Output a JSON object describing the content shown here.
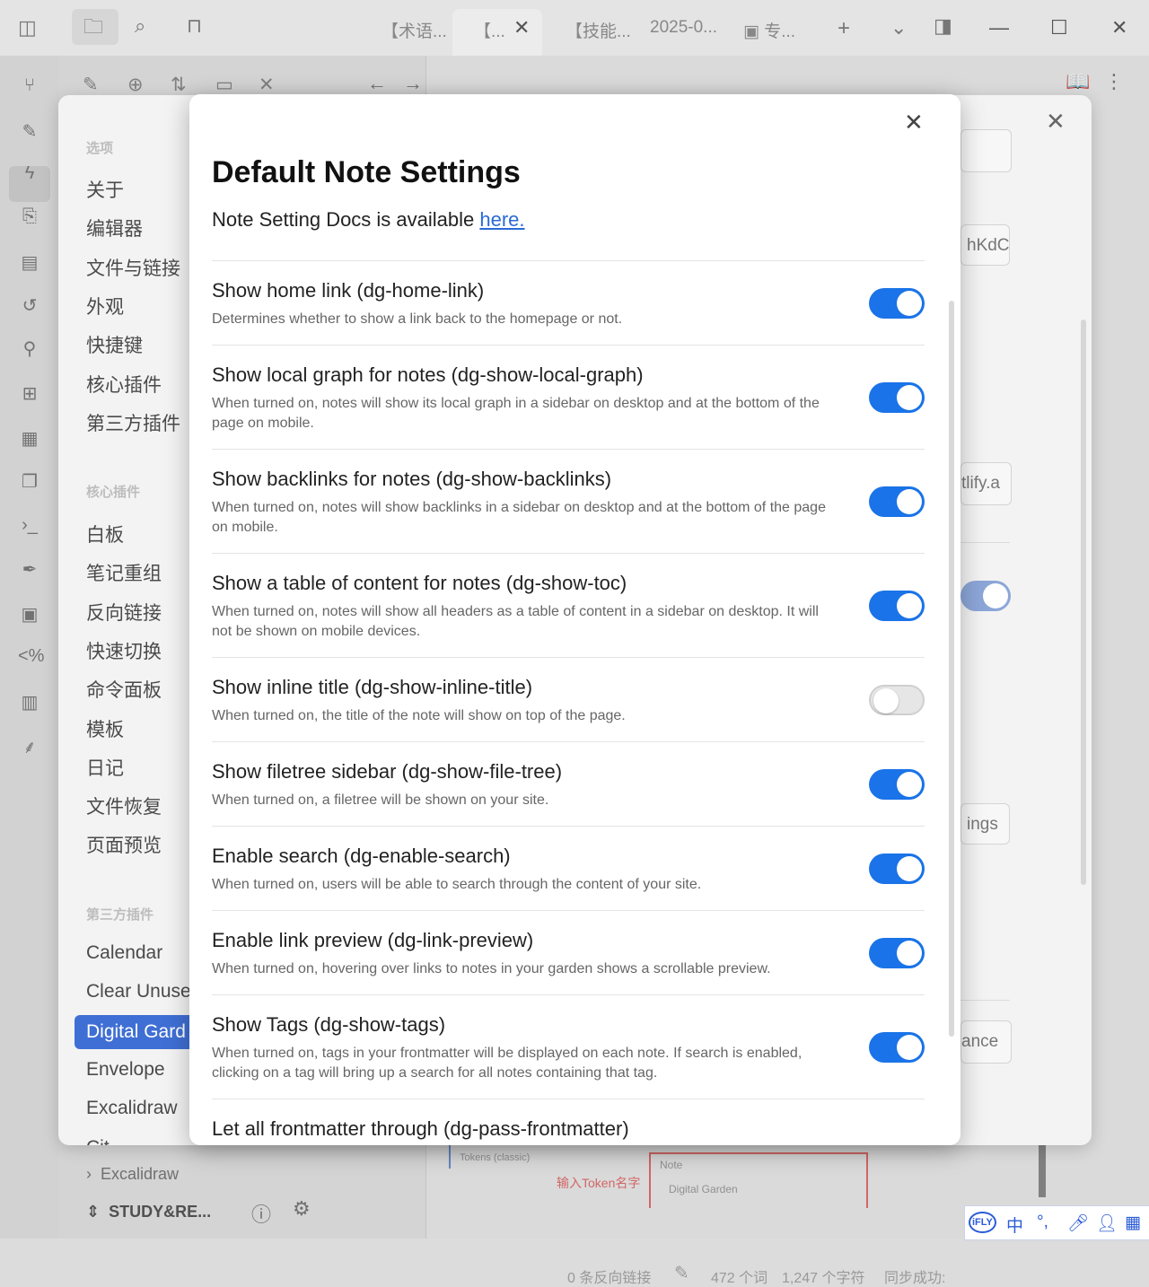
{
  "titlebar": {
    "tabs": [
      {
        "label": "【术语..."
      },
      {
        "label": "【..."
      },
      {
        "label": "【技能..."
      },
      {
        "label": "2025-0..."
      },
      {
        "label": "专..."
      }
    ],
    "icons": {
      "sidebar_toggle": "sidebar-icon",
      "files": "folder-icon",
      "search": "search-icon",
      "bookmarks": "bookmark-icon",
      "new_tab": "plus-icon",
      "tab_list": "chevron-down-icon",
      "right_sidebar": "sidebar-right-icon",
      "minimize": "minimize-icon",
      "maximize": "maximize-icon",
      "close": "close-icon"
    }
  },
  "file_pane": {
    "bottom_folder": "Excalidraw",
    "vault_name": "STUDY&RE..."
  },
  "statusbar": {
    "backlinks": "0 条反向链接",
    "words": "472 个词",
    "chars": "1,247 个字符",
    "sync": "同步成功:"
  },
  "editor_preview": {
    "tokens_label": "Tokens (classic)",
    "note_label": "Note",
    "input_hint": "输入Token名字",
    "field_value": "Digital Garden"
  },
  "settings": {
    "section_options": "选项",
    "options": [
      "关于",
      "编辑器",
      "文件与链接",
      "外观",
      "快捷键",
      "核心插件",
      "第三方插件"
    ],
    "section_core": "核心插件",
    "core_plugins": [
      "白板",
      "笔记重组",
      "反向链接",
      "快速切换",
      "命令面板",
      "模板",
      "日记",
      "文件恢复",
      "页面预览"
    ],
    "section_community": "第三方插件",
    "community_plugins": [
      "Calendar",
      "Clear Unuse",
      "Digital Gard",
      "Envelope",
      "Excalidraw",
      "Cit"
    ],
    "selected_plugin": "Digital Gard",
    "peek_fields": [
      "hKdC",
      "tlify.a",
      "ings",
      "ance"
    ]
  },
  "dialog": {
    "title": "Default Note Settings",
    "docs_text": "Note Setting Docs is available ",
    "docs_link": "here.",
    "rows": [
      {
        "name": "Show home link (dg-home-link)",
        "desc": "Determines whether to show a link back to the homepage or not.",
        "on": true
      },
      {
        "name": "Show local graph for notes (dg-show-local-graph)",
        "desc": "When turned on, notes will show its local graph in a sidebar on desktop and at the bottom of the page on mobile.",
        "on": true
      },
      {
        "name": "Show backlinks for notes (dg-show-backlinks)",
        "desc": "When turned on, notes will show backlinks in a sidebar on desktop and at the bottom of the page on mobile.",
        "on": true
      },
      {
        "name": "Show a table of content for notes (dg-show-toc)",
        "desc": "When turned on, notes will show all headers as a table of content in a sidebar on desktop. It will not be shown on mobile devices.",
        "on": true
      },
      {
        "name": "Show inline title (dg-show-inline-title)",
        "desc": "When turned on, the title of the note will show on top of the page.",
        "on": false
      },
      {
        "name": "Show filetree sidebar (dg-show-file-tree)",
        "desc": "When turned on, a filetree will be shown on your site.",
        "on": true
      },
      {
        "name": "Enable search (dg-enable-search)",
        "desc": "When turned on, users will be able to search through the content of your site.",
        "on": true
      },
      {
        "name": "Enable link preview (dg-link-preview)",
        "desc": "When turned on, hovering over links to notes in your garden shows a scrollable preview.",
        "on": true
      },
      {
        "name": "Show Tags (dg-show-tags)",
        "desc": "When turned on, tags in your frontmatter will be displayed on each note. If search is enabled, clicking on a tag will bring up a search for all notes containing that tag.",
        "on": true
      },
      {
        "name": "Let all frontmatter through (dg-pass-frontmatter)",
        "desc": "",
        "on": null
      }
    ]
  },
  "ime": {
    "logo": "iFLY",
    "lang": "中",
    "punct": "°,",
    "mic": "mic-icon",
    "user": "user-icon",
    "apps": "apps-icon"
  }
}
